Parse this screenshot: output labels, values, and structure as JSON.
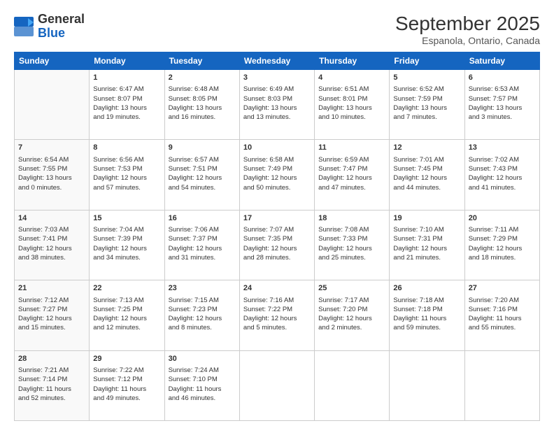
{
  "logo": {
    "line1": "General",
    "line2": "Blue"
  },
  "title": "September 2025",
  "subtitle": "Espanola, Ontario, Canada",
  "header": {
    "days": [
      "Sunday",
      "Monday",
      "Tuesday",
      "Wednesday",
      "Thursday",
      "Friday",
      "Saturday"
    ]
  },
  "rows": [
    [
      {
        "date": "",
        "text": ""
      },
      {
        "date": "1",
        "text": "Sunrise: 6:47 AM\nSunset: 8:07 PM\nDaylight: 13 hours\nand 19 minutes."
      },
      {
        "date": "2",
        "text": "Sunrise: 6:48 AM\nSunset: 8:05 PM\nDaylight: 13 hours\nand 16 minutes."
      },
      {
        "date": "3",
        "text": "Sunrise: 6:49 AM\nSunset: 8:03 PM\nDaylight: 13 hours\nand 13 minutes."
      },
      {
        "date": "4",
        "text": "Sunrise: 6:51 AM\nSunset: 8:01 PM\nDaylight: 13 hours\nand 10 minutes."
      },
      {
        "date": "5",
        "text": "Sunrise: 6:52 AM\nSunset: 7:59 PM\nDaylight: 13 hours\nand 7 minutes."
      },
      {
        "date": "6",
        "text": "Sunrise: 6:53 AM\nSunset: 7:57 PM\nDaylight: 13 hours\nand 3 minutes."
      }
    ],
    [
      {
        "date": "7",
        "text": "Sunrise: 6:54 AM\nSunset: 7:55 PM\nDaylight: 13 hours\nand 0 minutes."
      },
      {
        "date": "8",
        "text": "Sunrise: 6:56 AM\nSunset: 7:53 PM\nDaylight: 12 hours\nand 57 minutes."
      },
      {
        "date": "9",
        "text": "Sunrise: 6:57 AM\nSunset: 7:51 PM\nDaylight: 12 hours\nand 54 minutes."
      },
      {
        "date": "10",
        "text": "Sunrise: 6:58 AM\nSunset: 7:49 PM\nDaylight: 12 hours\nand 50 minutes."
      },
      {
        "date": "11",
        "text": "Sunrise: 6:59 AM\nSunset: 7:47 PM\nDaylight: 12 hours\nand 47 minutes."
      },
      {
        "date": "12",
        "text": "Sunrise: 7:01 AM\nSunset: 7:45 PM\nDaylight: 12 hours\nand 44 minutes."
      },
      {
        "date": "13",
        "text": "Sunrise: 7:02 AM\nSunset: 7:43 PM\nDaylight: 12 hours\nand 41 minutes."
      }
    ],
    [
      {
        "date": "14",
        "text": "Sunrise: 7:03 AM\nSunset: 7:41 PM\nDaylight: 12 hours\nand 38 minutes."
      },
      {
        "date": "15",
        "text": "Sunrise: 7:04 AM\nSunset: 7:39 PM\nDaylight: 12 hours\nand 34 minutes."
      },
      {
        "date": "16",
        "text": "Sunrise: 7:06 AM\nSunset: 7:37 PM\nDaylight: 12 hours\nand 31 minutes."
      },
      {
        "date": "17",
        "text": "Sunrise: 7:07 AM\nSunset: 7:35 PM\nDaylight: 12 hours\nand 28 minutes."
      },
      {
        "date": "18",
        "text": "Sunrise: 7:08 AM\nSunset: 7:33 PM\nDaylight: 12 hours\nand 25 minutes."
      },
      {
        "date": "19",
        "text": "Sunrise: 7:10 AM\nSunset: 7:31 PM\nDaylight: 12 hours\nand 21 minutes."
      },
      {
        "date": "20",
        "text": "Sunrise: 7:11 AM\nSunset: 7:29 PM\nDaylight: 12 hours\nand 18 minutes."
      }
    ],
    [
      {
        "date": "21",
        "text": "Sunrise: 7:12 AM\nSunset: 7:27 PM\nDaylight: 12 hours\nand 15 minutes."
      },
      {
        "date": "22",
        "text": "Sunrise: 7:13 AM\nSunset: 7:25 PM\nDaylight: 12 hours\nand 12 minutes."
      },
      {
        "date": "23",
        "text": "Sunrise: 7:15 AM\nSunset: 7:23 PM\nDaylight: 12 hours\nand 8 minutes."
      },
      {
        "date": "24",
        "text": "Sunrise: 7:16 AM\nSunset: 7:22 PM\nDaylight: 12 hours\nand 5 minutes."
      },
      {
        "date": "25",
        "text": "Sunrise: 7:17 AM\nSunset: 7:20 PM\nDaylight: 12 hours\nand 2 minutes."
      },
      {
        "date": "26",
        "text": "Sunrise: 7:18 AM\nSunset: 7:18 PM\nDaylight: 11 hours\nand 59 minutes."
      },
      {
        "date": "27",
        "text": "Sunrise: 7:20 AM\nSunset: 7:16 PM\nDaylight: 11 hours\nand 55 minutes."
      }
    ],
    [
      {
        "date": "28",
        "text": "Sunrise: 7:21 AM\nSunset: 7:14 PM\nDaylight: 11 hours\nand 52 minutes."
      },
      {
        "date": "29",
        "text": "Sunrise: 7:22 AM\nSunset: 7:12 PM\nDaylight: 11 hours\nand 49 minutes."
      },
      {
        "date": "30",
        "text": "Sunrise: 7:24 AM\nSunset: 7:10 PM\nDaylight: 11 hours\nand 46 minutes."
      },
      {
        "date": "",
        "text": ""
      },
      {
        "date": "",
        "text": ""
      },
      {
        "date": "",
        "text": ""
      },
      {
        "date": "",
        "text": ""
      }
    ]
  ]
}
